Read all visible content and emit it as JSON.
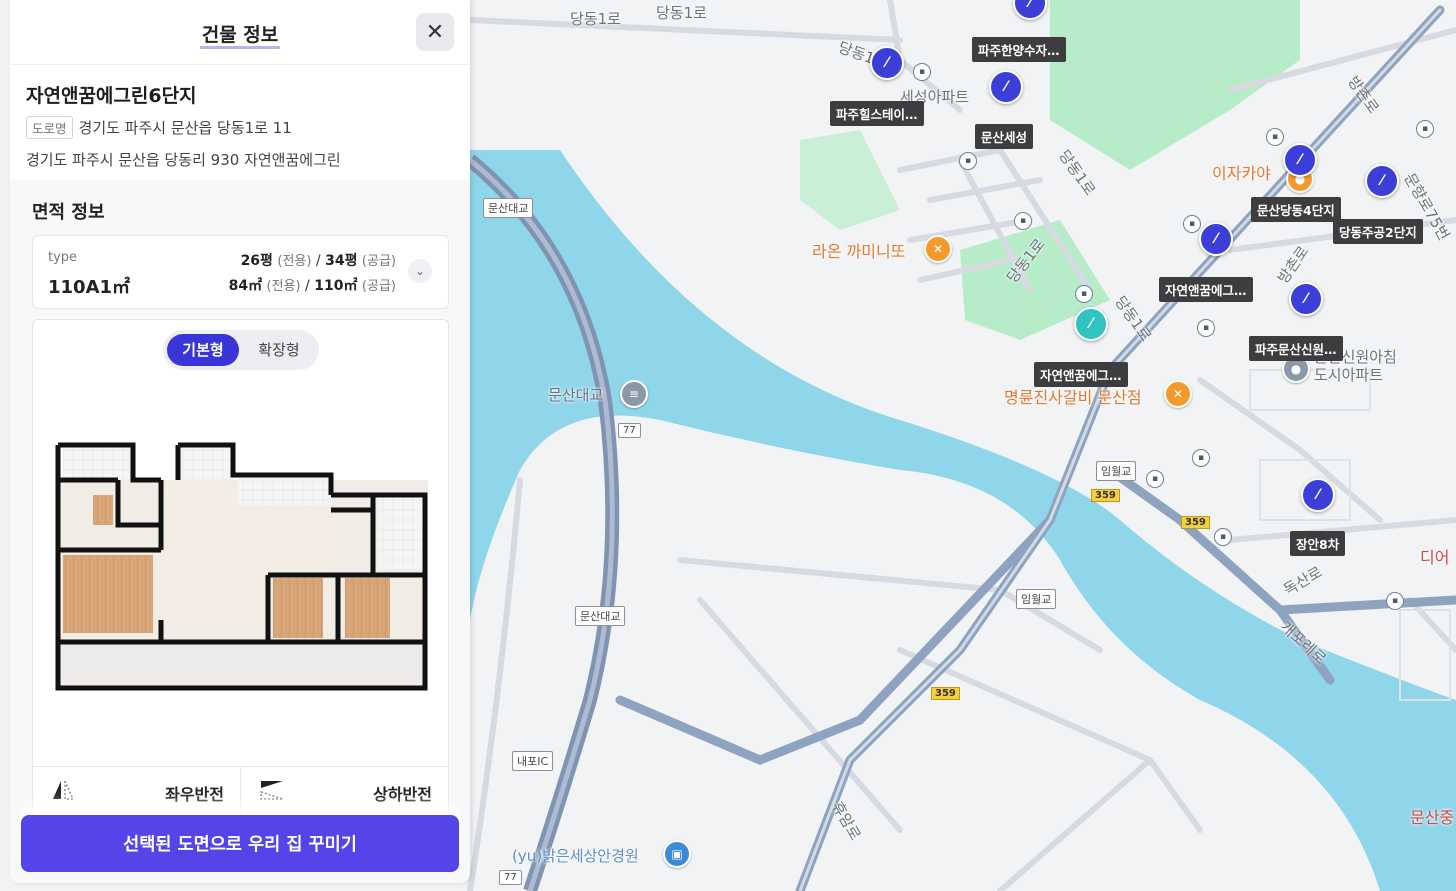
{
  "panel": {
    "title": "건물 정보",
    "building_name": "자연앤꿈에그린6단지",
    "road_chip": "도로명",
    "road_address": "경기도 파주시 문산읍 당동1로 11",
    "jibun_address": "경기도 파주시 문산읍 당동리 930 자연앤꿈에그린",
    "area_title": "면적 정보",
    "type_label": "type",
    "type_value": "110A1㎡",
    "pyeong_exclusive": "26평",
    "pyeong_exclusive_note": "(전용)",
    "pyeong_supply": "34평",
    "pyeong_supply_note": "(공급)",
    "sqm_exclusive": "84㎡",
    "sqm_exclusive_note": "(전용)",
    "sqm_supply": "110㎡",
    "sqm_supply_note": "(공급)",
    "seg_basic": "기본형",
    "seg_extended": "확장형",
    "flip_lr": "좌우반전",
    "flip_ud": "상하반전",
    "cta": "선택된 도면으로 우리 집 꾸미기"
  },
  "map": {
    "labels": {
      "dangdong1ro_top": "당동1로",
      "dangdong1ro_top2": "당동1로",
      "dangdong_a": "당동1",
      "dangdong_b": "당동1로",
      "dangdong_c": "당동1로",
      "dangdong_d": "당동1로",
      "bangchon1": "방촌로",
      "bangchon2": "방촌로",
      "munhyang": "문향로75번",
      "doksan": "독산로",
      "gaepo": "개포레로",
      "huimro": "휴암로",
      "munsan_bridge": "문산대교",
      "apt_seseong": "세성아파트",
      "apt_sinwon": "문산신원아침\n도시아파트",
      "izakaya": "이자카야",
      "raon": "라온 까미니또",
      "myeongryun": "명륜진사갈비 문산점",
      "yu_garden": "(yu)밝은세상안경원",
      "dieo": "디어",
      "munsanjung": "문산중"
    },
    "tags": {
      "munsan_daegyo_1": "문산대교",
      "munsan_daegyo_2": "문산대교",
      "imwolgyo_1": "임월교",
      "imwolgyo_2": "임월교",
      "naepo_ic": "내포IC"
    },
    "routes": {
      "r77_a": "77",
      "r77_b": "77",
      "r359_a": "359",
      "r359_b": "359",
      "r359_c": "359"
    },
    "markers": {
      "pajuhanyang": "파주한양수자…",
      "pajuhills": "파주힐스테이…",
      "munsanseseong": "문산세성",
      "munsandangdong4": "문산당동4단지",
      "dangdongjugong2": "당동주공2단지",
      "jayeon_a": "자연앤꿈에그…",
      "pajumunsansinwon": "파주문산신원…",
      "jayeon_b": "자연앤꿈에그…",
      "jangan8": "장안8차"
    }
  }
}
